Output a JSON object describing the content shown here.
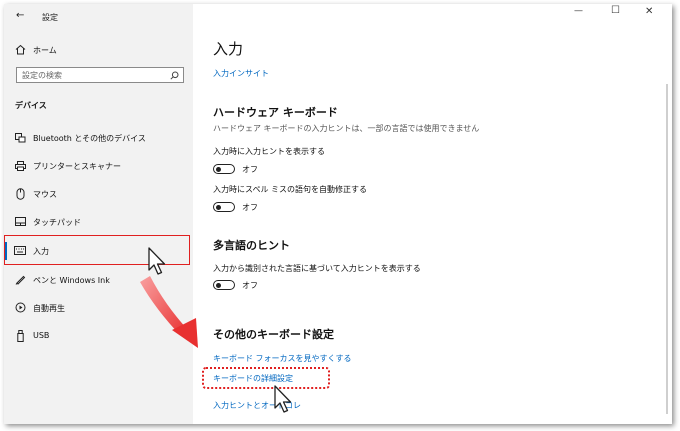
{
  "window": {
    "title": "設定",
    "controls": {
      "minimize": "—",
      "maximize": "☐",
      "close": "✕"
    }
  },
  "sidebar": {
    "home_label": "ホーム",
    "search_placeholder": "設定の検索",
    "section_label": "デバイス",
    "items": [
      {
        "label": "Bluetooth とその他のデバイス",
        "icon": "bluetooth-device-icon"
      },
      {
        "label": "プリンターとスキャナー",
        "icon": "printer-icon"
      },
      {
        "label": "マウス",
        "icon": "mouse-icon"
      },
      {
        "label": "タッチパッド",
        "icon": "touchpad-icon"
      },
      {
        "label": "入力",
        "icon": "keyboard-icon",
        "selected": true
      },
      {
        "label": "ペンと Windows Ink",
        "icon": "pen-icon"
      },
      {
        "label": "自動再生",
        "icon": "autoplay-icon"
      },
      {
        "label": "USB",
        "icon": "usb-icon"
      }
    ]
  },
  "main": {
    "title": "入力",
    "insights_link": "入力インサイト",
    "hardware_keyboard": {
      "heading": "ハードウェア キーボード",
      "description": "ハードウェア キーボードの入力ヒントは、一部の言語では使用できません",
      "settings": [
        {
          "label": "入力時に入力ヒントを表示する",
          "state": "オフ"
        },
        {
          "label": "入力時にスペル ミスの語句を自動修正する",
          "state": "オフ"
        }
      ]
    },
    "multilingual": {
      "heading": "多言語のヒント",
      "settings": [
        {
          "label": "入力から識別された言語に基づいて入力ヒントを表示する",
          "state": "オフ"
        }
      ]
    },
    "other_keyboard": {
      "heading": "その他のキーボード設定",
      "links": [
        "キーボード フォーカスを見やすくする",
        "キーボードの詳細設定",
        "入力ヒントとオートコレ"
      ]
    }
  },
  "colors": {
    "accent": "#0067c0",
    "sidebar_bg": "#f2f2f2",
    "highlight_red": "#e02020",
    "arrow_red": "#e83030"
  }
}
